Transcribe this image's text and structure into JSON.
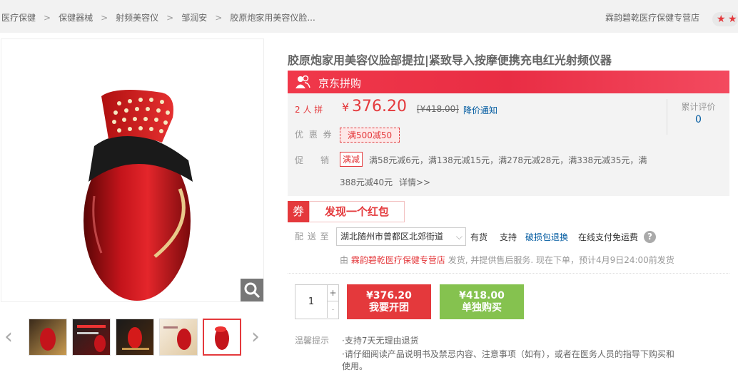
{
  "breadcrumb": {
    "items": [
      "医疗保健",
      "保健器械",
      "射频美容仪",
      "邹润安",
      "胶原炮家用美容仪脸..."
    ],
    "separator": ">"
  },
  "shop": {
    "name": "霖韵碧乾医疗保健专营店",
    "stars_icon": "star-icon"
  },
  "product": {
    "title": "胶原炮家用美容仪脸部提拉|紧致导入按摩便携充电红光射频仪器"
  },
  "group_buy": {
    "banner_label": "京东拼购",
    "group_size_label": "2 人 拼",
    "price_symbol": "¥",
    "price": "376.20",
    "original_price": "[¥418.00]",
    "price_alert": "降价通知",
    "review_label": "累计评价",
    "review_count": "0"
  },
  "coupons": {
    "label": "优 惠 券",
    "tag": "满500减50"
  },
  "promotion": {
    "label": "促　　销",
    "tag": "满减",
    "text_line1": "满58元减6元，满138元减15元，满278元减28元，满338元减35元，满",
    "text_line2": "388元减40元",
    "details": "详情>>"
  },
  "red_packet": {
    "icon_text": "券",
    "label": "发现一个红包"
  },
  "delivery": {
    "label": "配 送 至",
    "address": "湖北随州市曾都区北郊街道",
    "stock": "有货",
    "support_label": "支持",
    "support_link": "破损包退换",
    "payment": "在线支付免运费",
    "help_icon": "?",
    "ship_prefix": "由",
    "ship_shop": "霖韵碧乾医疗保健专营店",
    "ship_suffix": "发货, 并提供售后服务. 现在下单，预计4月9日24:00前发货"
  },
  "purchase": {
    "quantity": "1",
    "plus": "+",
    "minus": "-",
    "group_price": "¥376.20",
    "group_label": "我要开团",
    "single_price": "¥418.00",
    "single_label": "单独购买"
  },
  "tips": {
    "label": "温馨提示",
    "line1": "·支持7天无理由退货",
    "line2": "·请仔细阅读产品说明书及禁忌内容、注意事项（如有），或者在医务人员的指导下购买和",
    "line3": "使用。"
  },
  "colors": {
    "accent": "#e4393c",
    "green": "#85c24f",
    "link": "#005aa0"
  }
}
